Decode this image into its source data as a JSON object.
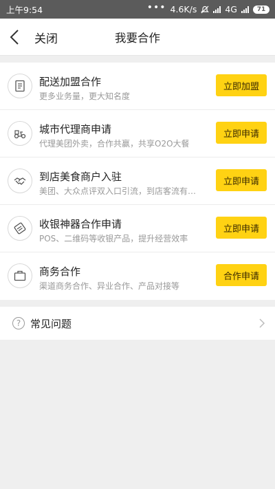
{
  "status_bar": {
    "time": "上午9:54",
    "dots": "•••",
    "speed": "4.6K/s",
    "network": "4G",
    "battery": "71"
  },
  "header": {
    "close_label": "关闭",
    "title": "我要合作"
  },
  "items": [
    {
      "title": "配送加盟合作",
      "subtitle": "更多业务量，更大知名度",
      "button": "立即加盟",
      "icon": "document-icon"
    },
    {
      "title": "城市代理商申请",
      "subtitle": "代理美团外卖，合作共赢，共享O2O大餐",
      "button": "立即申请",
      "icon": "scooter-icon"
    },
    {
      "title": "到店美食商户入驻",
      "subtitle": "美团、大众点评双入口引流，到店客流有保障",
      "button": "立即申请",
      "icon": "handshake-icon"
    },
    {
      "title": "收银神器合作申请",
      "subtitle": "POS、二维码等收银产品，提升经营效率",
      "button": "立即申请",
      "icon": "pos-icon"
    },
    {
      "title": "商务合作",
      "subtitle": "渠道商务合作、异业合作、产品对接等",
      "button": "合作申请",
      "icon": "briefcase-icon"
    }
  ],
  "faq": {
    "label": "常见问题",
    "icon_glyph": "?"
  },
  "colors": {
    "accent": "#ffd213",
    "status_bar": "#5b5b5b",
    "background": "#efefef"
  }
}
